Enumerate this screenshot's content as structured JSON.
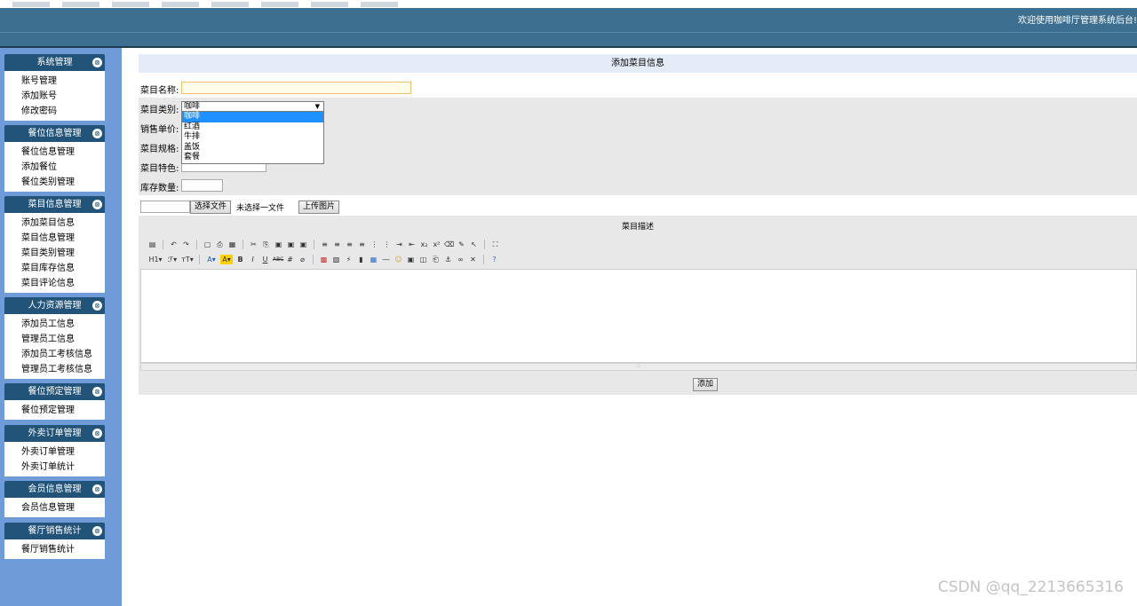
{
  "header": {
    "welcome": "欢迎使用咖啡厅管理系统后台!"
  },
  "sidebar": {
    "menus": [
      {
        "title": "系统管理",
        "items": [
          "账号管理",
          "添加账号",
          "修改密码"
        ]
      },
      {
        "title": "餐位信息管理",
        "items": [
          "餐位信息管理",
          "添加餐位",
          "餐位类别管理"
        ]
      },
      {
        "title": "菜目信息管理",
        "items": [
          "添加菜目信息",
          "菜目信息管理",
          "菜目类别管理",
          "菜目库存信息",
          "菜目评论信息"
        ]
      },
      {
        "title": "人力资源管理",
        "items": [
          "添加员工信息",
          "管理员工信息",
          "添加员工考核信息",
          "管理员工考核信息"
        ]
      },
      {
        "title": "餐位预定管理",
        "items": [
          "餐位预定管理"
        ]
      },
      {
        "title": "外卖订单管理",
        "items": [
          "外卖订单管理",
          "外卖订单统计"
        ]
      },
      {
        "title": "会员信息管理",
        "items": [
          "会员信息管理"
        ]
      },
      {
        "title": "餐厅销售统计",
        "items": [
          "餐厅销售统计"
        ]
      }
    ]
  },
  "form": {
    "title": "添加菜目信息",
    "name_label": "菜目名称:",
    "category_label": "菜目类别:",
    "price_label": "销售单价:",
    "spec_label": "菜目规格:",
    "feature_label": "菜目特色:",
    "stock_label": "库存数量:",
    "category_selected": "咖啡",
    "category_options": [
      "咖啡",
      "红酒",
      "牛排",
      "盖饭",
      "套餐"
    ],
    "choose_file": "选择文件",
    "no_file": "未选择一文件",
    "upload": "上传图片",
    "desc_title": "菜目描述",
    "submit": "添加"
  },
  "watermark": "CSDN @qq_2213665316"
}
